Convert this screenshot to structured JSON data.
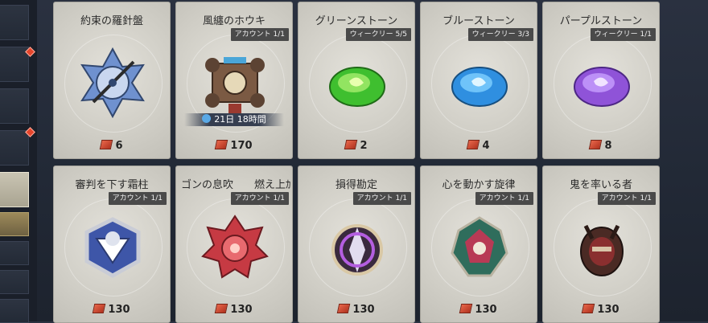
{
  "sidebar": {
    "tabs": [
      "",
      "",
      "",
      "",
      "",
      "",
      "",
      ""
    ]
  },
  "cards": [
    {
      "title": "約束の羅針盤",
      "tag": "",
      "price": "6",
      "art": "compass-icon",
      "color": "#5f86c8"
    },
    {
      "title": "風纏のホウキ",
      "tag": "アカウント 1/1",
      "price": "170",
      "timer": "21日 18時間",
      "art": "broom-icon",
      "color": "#4aa6d8"
    },
    {
      "title": "グリーンストーン",
      "tag": "ウィークリー 5/5",
      "price": "2",
      "art": "green-stone-icon",
      "color": "#3fbf2f"
    },
    {
      "title": "ブルーストーン",
      "tag": "ウィークリー 3/3",
      "price": "4",
      "art": "blue-stone-icon",
      "color": "#2f8fe0"
    },
    {
      "title": "パープルストーン",
      "tag": "ウィークリー 1/1",
      "price": "8",
      "art": "purple-stone-icon",
      "color": "#8f53d8"
    },
    {
      "title": "審判を下す霜柱",
      "tag": "アカウント 1/1",
      "price": "130",
      "art": "frost-emblem-icon",
      "color": "#3e56a8"
    },
    {
      "title": "ゴンの息吹　　燃え上ｶ",
      "tag": "アカウント 1/1",
      "price": "130",
      "art": "flame-emblem-icon",
      "color": "#c63a43"
    },
    {
      "title": "損得勘定",
      "tag": "アカウント 1/1",
      "price": "130",
      "art": "purple-emblem-icon",
      "color": "#7a3aa8"
    },
    {
      "title": "心を動かす旋律",
      "tag": "アカウント 1/1",
      "price": "130",
      "art": "melody-emblem-icon",
      "color": "#b83a55"
    },
    {
      "title": "鬼を率いる者",
      "tag": "アカウント 1/1",
      "price": "130",
      "art": "oni-emblem-icon",
      "color": "#8a2f2f"
    }
  ],
  "currency_icon": "ticket-icon"
}
